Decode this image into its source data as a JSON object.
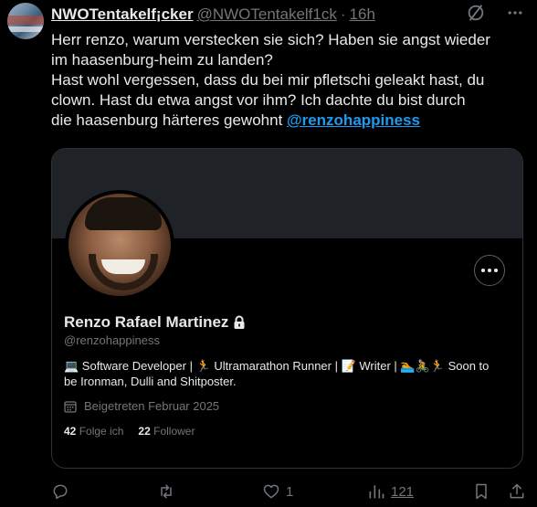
{
  "tweet": {
    "author_name": "NWOTentakelf¡cker",
    "author_handle": "@NWOTentakelf1ck",
    "separator": "·",
    "time": "16h",
    "lines": [
      "Herr renzo, warum verstecken sie sich? Haben sie angst wieder",
      "im haasenburg-heim zu landen?",
      "Hast wohl vergessen, dass du bei mir pfletschi geleakt hast, du",
      "clown. Hast du etwa angst vor ihm? Ich dachte du bist durch"
    ],
    "last_line_text": "die haasenburg härteres gewohnt ",
    "mention": "@renzohappiness"
  },
  "icons": {
    "grok": "grok-slash-icon",
    "more": "more-horizontal-icon"
  },
  "card": {
    "name": "Renzo Rafael Martinez",
    "handle": "@renzohappiness",
    "bio_line1": "💻 Software Developer | 🏃 Ultramarathon Runner | 📝 Writer | 🏊🚴🏃 Soon to",
    "bio_line2": "be Ironman, Dulli and Shitposter.",
    "joined": "Beigetreten Februar 2025",
    "following_count": "42",
    "following_label": "Folge ich",
    "followers_count": "22",
    "followers_label": "Follower"
  },
  "actions": {
    "likes": "1",
    "views": "121"
  }
}
